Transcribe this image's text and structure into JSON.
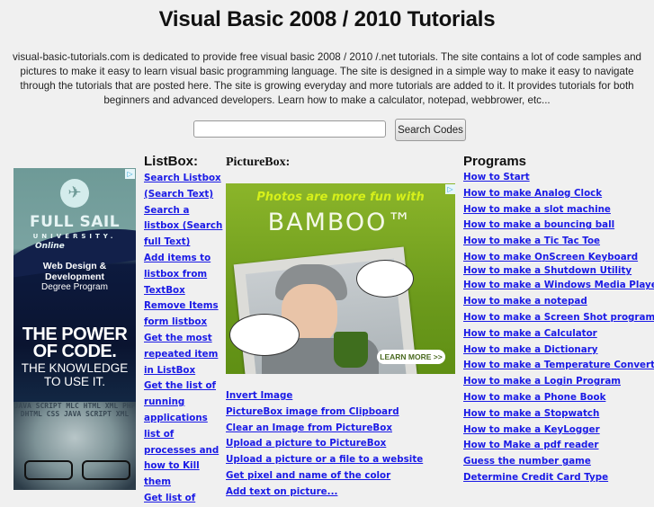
{
  "header": {
    "title": "Visual Basic 2008 / 2010 Tutorials",
    "intro": "visual-basic-tutorials.com is dedicated to provide free visual basic 2008 / 2010 /.net tutorials. The site contains a lot of code samples and pictures to make it easy to learn visual basic programming language. The site is designed in a simple way to make it easy to navigate through the tutorials that are posted here. The site is growing everyday and more tutorials are added to it. It provides tutorials for both beginners and advanced developers. Learn how to make a calculator, notepad, webbrower, etc..."
  },
  "search": {
    "value": "",
    "placeholder": "",
    "button_label": "Search Codes"
  },
  "listbox": {
    "heading": "ListBox:",
    "links": [
      "Search Listbox (Search Text)",
      "Search a listbox (Search full Text)",
      "Add items to listbox from TextBox",
      "Remove Items form listbox",
      "Get the most repeated item in ListBox",
      "Get the list of running applications",
      "list of processes and how to Kill them",
      "Get list of"
    ]
  },
  "picturebox": {
    "heading": "PictureBox:",
    "links": [
      "Invert Image",
      "PictureBox image from Clipboard",
      "Clear an Image from PictureBox",
      "Upload a picture to PictureBox",
      "Upload a picture or a file to a website",
      "Get pixel and name of the color",
      "Add text on picture..."
    ]
  },
  "programs": {
    "heading": "Programs",
    "links": [
      "How to Start",
      "How to make Analog Clock",
      "How to make a slot machine",
      "How to make a bouncing ball",
      "How to make a Tic Tac Toe",
      "How to make OnScreen Keyboard",
      "How to make a Shutdown Utility",
      "How to make a Windows Media Player",
      "How to make a notepad",
      "How to make a Screen Shot program",
      "How to make a Calculator",
      "How to make a Dictionary",
      "How to make a Temperature Converter",
      "How to make a Login Program",
      "How to make a Phone Book",
      "How to make a Stopwatch",
      "How to make a KeyLogger",
      "How to Make a pdf reader",
      "Guess the number game",
      "Determine Credit Card Type"
    ]
  },
  "ads": {
    "left": {
      "logo_icon": "airplane-icon",
      "brand": "FULL SAIL",
      "university": "UNIVERSITY.",
      "online": "Online",
      "program_line1": "Web Design &",
      "program_line2": "Development",
      "program_line3": "Degree Program",
      "headline1": "THE POWER",
      "headline2": "OF CODE.",
      "sub1": "THE KNOWLEDGE",
      "sub2": "TO USE IT.",
      "face_text": "JAVA SCRIPT MLC HTML XML PHP DHTML CSS JAVA SCRIPT XML"
    },
    "right": {
      "tagline": "Photos are more fun with",
      "brand": "BAMBOO™",
      "cta": "LEARN MORE >>"
    },
    "adchoices_icon": "▷"
  }
}
